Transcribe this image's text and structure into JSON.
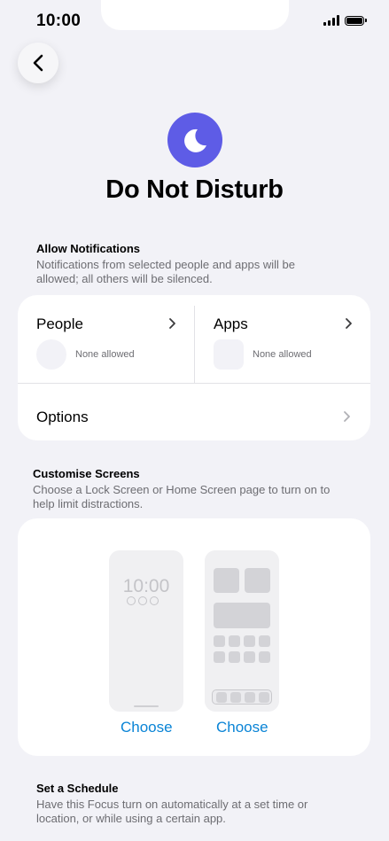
{
  "status_bar": {
    "time": "10:00"
  },
  "header": {
    "back_icon": "chevron-left-icon",
    "focus_icon": "moon-icon",
    "focus_icon_color": "#5e5ce6",
    "title": "Do Not Disturb"
  },
  "allow_notifications": {
    "heading": "Allow Notifications",
    "description_line1": "Notifications from selected people and apps will be",
    "description_line2": "allowed; all others will be silenced.",
    "people": {
      "label": "People",
      "status": "None allowed"
    },
    "apps": {
      "label": "Apps",
      "status": "None allowed"
    },
    "options": {
      "label": "Options"
    }
  },
  "customise_screens": {
    "heading": "Customise Screens",
    "description_line1": "Choose a Lock Screen or Home Screen page to turn on to",
    "description_line2": "help limit distractions.",
    "lock_screen": {
      "time": "10:00",
      "choose_label": "Choose"
    },
    "home_screen": {
      "choose_label": "Choose"
    },
    "accent_color": "#0a84d6"
  },
  "schedule": {
    "heading": "Set a Schedule",
    "description_line1": "Have this Focus turn on automatically at a set time or",
    "description_line2": "location, or while using a certain app."
  }
}
